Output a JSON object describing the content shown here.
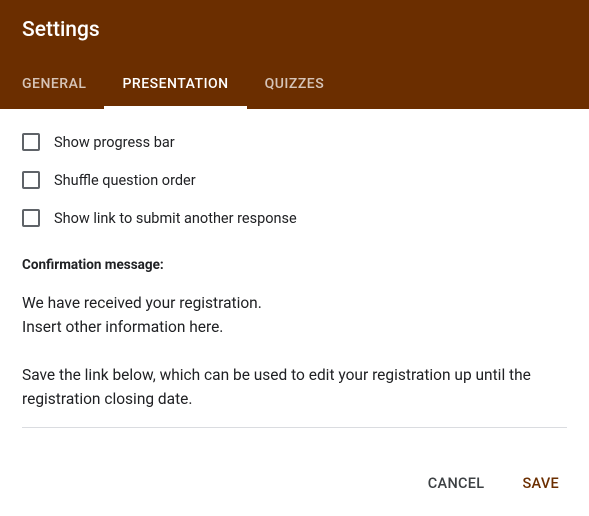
{
  "header": {
    "title": "Settings",
    "tabs": [
      {
        "label": "GENERAL",
        "active": false
      },
      {
        "label": "PRESENTATION",
        "active": true
      },
      {
        "label": "QUIZZES",
        "active": false
      }
    ]
  },
  "presentation": {
    "options": [
      {
        "label": "Show progress bar",
        "checked": false
      },
      {
        "label": "Shuffle question order",
        "checked": false
      },
      {
        "label": "Show link to submit another response",
        "checked": false
      }
    ],
    "confirmation_label": "Confirmation message:",
    "confirmation_text": "We have received your registration.\nInsert other information here.\n\nSave the link below, which can be used to edit your registration up until the registration closing date."
  },
  "footer": {
    "cancel_label": "CANCEL",
    "save_label": "SAVE"
  }
}
